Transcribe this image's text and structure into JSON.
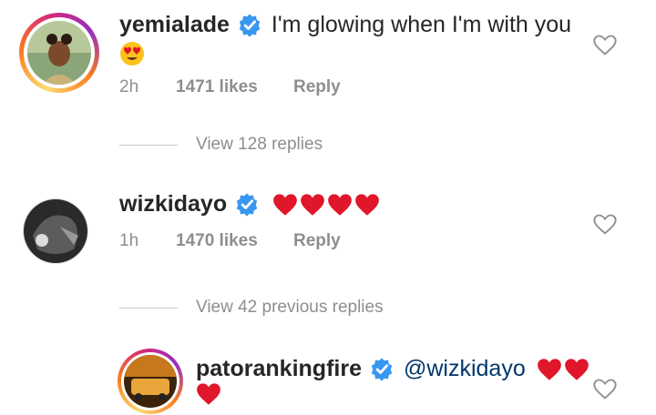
{
  "comments": [
    {
      "username": "yemialade",
      "text": "I'm glowing when I'm with you",
      "emoji": "heart-eyes-emoji",
      "time": "2h",
      "likes": "1471 likes",
      "reply": "Reply"
    },
    {
      "username": "wizkidayo",
      "hearts": 4,
      "time": "1h",
      "likes": "1470 likes",
      "reply": "Reply"
    },
    {
      "username": "patorankingfire",
      "mention": "@wizkidayo",
      "hearts": 3
    }
  ],
  "view_replies_1": "View 128 replies",
  "view_replies_2": "View 42 previous replies",
  "colors": {
    "verified": "#3897f0",
    "heart_red": "#e0162b",
    "meta": "#8e8e8e",
    "mention": "#00376b"
  }
}
